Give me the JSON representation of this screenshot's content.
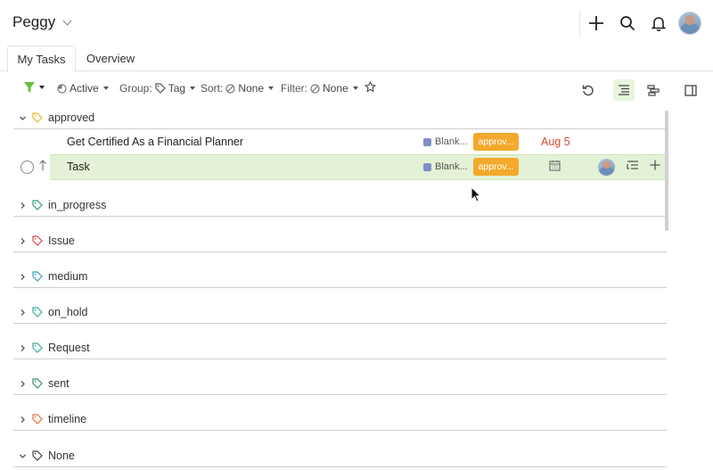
{
  "header": {
    "workspace": "Peggy",
    "icons": [
      "plus-icon",
      "search-icon",
      "bell-icon"
    ]
  },
  "tabs": [
    {
      "label": "My Tasks",
      "active": true
    },
    {
      "label": "Overview",
      "active": false
    }
  ],
  "toolbar": {
    "active_label": "Active",
    "group_label": "Group:",
    "group_value": "Tag",
    "sort_label": "Sort:",
    "sort_value": "None",
    "filter_label": "Filter:",
    "filter_value": "None"
  },
  "groups": [
    {
      "label": "approved",
      "expanded": true,
      "tag_color": "#e8b931"
    },
    {
      "label": "in_progress",
      "expanded": false,
      "tag_color": "#2f9e7a"
    },
    {
      "label": "Issue",
      "expanded": false,
      "tag_color": "#d84a4a"
    },
    {
      "label": "medium",
      "expanded": false,
      "tag_color": "#3aa2c2"
    },
    {
      "label": "on_hold",
      "expanded": false,
      "tag_color": "#3aa89a"
    },
    {
      "label": "Request",
      "expanded": false,
      "tag_color": "#3aa89a"
    },
    {
      "label": "sent",
      "expanded": false,
      "tag_color": "#3a8a7a"
    },
    {
      "label": "timeline",
      "expanded": false,
      "tag_color": "#e0763a"
    },
    {
      "label": "None",
      "expanded": true,
      "tag_color": "#444444"
    }
  ],
  "tasks": [
    {
      "name": "Get Certified As a Financial Planner",
      "project": "Blank...",
      "status": "approv...",
      "due": "Aug 5"
    },
    {
      "name": "Task",
      "project": "Blank...",
      "status": "approv...",
      "due": ""
    }
  ],
  "colors": {
    "accent_green": "#6bbf3a",
    "status_orange": "#f3a92c",
    "due_red": "#d24a3a",
    "highlight": "#e3f2d6"
  }
}
